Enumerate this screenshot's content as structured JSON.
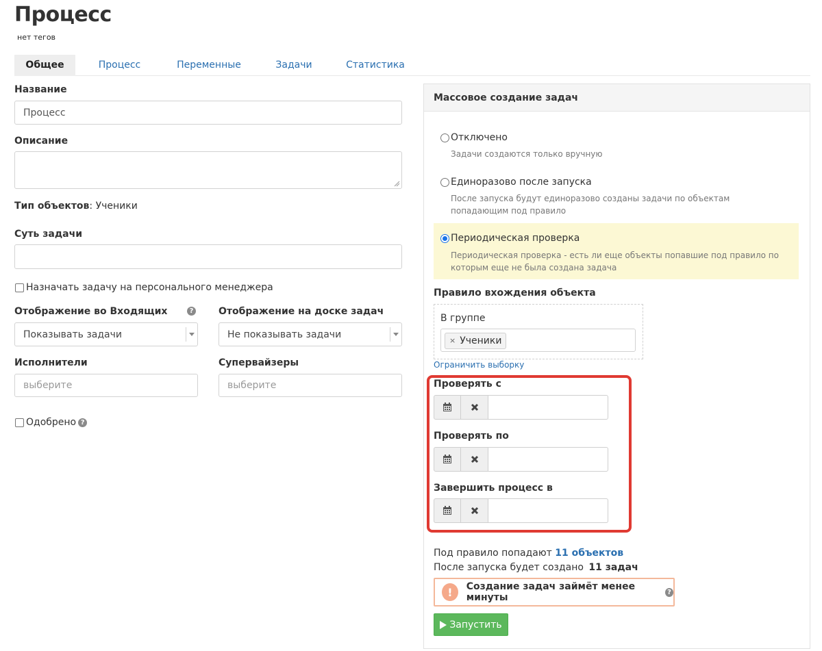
{
  "page": {
    "title": "Процесс",
    "tags": "нет тегов"
  },
  "tabs": [
    {
      "label": "Общее",
      "active": true
    },
    {
      "label": "Процесс",
      "active": false
    },
    {
      "label": "Переменные",
      "active": false
    },
    {
      "label": "Задачи",
      "active": false
    },
    {
      "label": "Статистика",
      "active": false
    }
  ],
  "form": {
    "name_label": "Название",
    "name_value": "Процесс",
    "description_label": "Описание",
    "description_value": "",
    "object_type_label": "Тип объектов",
    "object_type_value": ": Ученики",
    "task_essence_label": "Суть задачи",
    "task_essence_value": "",
    "assign_manager_label": "Назначать задачу на персонального менеджера",
    "assign_manager_checked": false,
    "inbox_display_label": "Отображение во Входящих",
    "inbox_display_value": "Показывать задачи",
    "board_display_label": "Отображение на доске задач",
    "board_display_value": "Не показывать задачи",
    "executors_label": "Исполнители",
    "executors_placeholder": "выберите",
    "supervisors_label": "Супервайзеры",
    "supervisors_placeholder": "выберите",
    "approved_label": "Одобрено",
    "approved_checked": false,
    "help_glyph": "?"
  },
  "mass_panel": {
    "title": "Массовое создание задач",
    "options": [
      {
        "title": "Отключено",
        "desc": "Задачи создаются только вручную",
        "selected": false
      },
      {
        "title": "Единоразово после запуска",
        "desc": "После запуска будут единоразово созданы задачи по объектам попадающим под правило",
        "selected": false
      },
      {
        "title": "Периодическая проверка",
        "desc": "Периодическая проверка - есть ли еще объекты попавшие под правило по которым еще не была создана задача",
        "selected": true
      }
    ],
    "rule_label": "Правило вхождения объекта",
    "rule_group_label": "В группе",
    "rule_chip": "Ученики",
    "rule_chip_remove": "×",
    "limit_link": "Ограничить выборку",
    "check_from_label": "Проверять с",
    "check_to_label": "Проверять по",
    "finish_label": "Завершить процесс в",
    "summary_prefix": "Под правило попадают",
    "summary_count_link": "11 объектов",
    "created_prefix": "После запуска будет создано",
    "created_count": "11 задач",
    "alert_mark": "!",
    "alert_text": "Создание задач займёт менее минуты",
    "start_button": "Запустить"
  },
  "icons": [
    "calendar-icon",
    "clear-icon",
    "help-icon",
    "play-icon",
    "warning-icon",
    "caret-down-icon"
  ],
  "colors": {
    "link": "#2a6fb0",
    "highlight": "#fcf8d4",
    "frame_red": "#e03a32",
    "button_green": "#5cb85c",
    "alert_border": "#f4b89a",
    "radio_selected": "#1a73e8"
  }
}
